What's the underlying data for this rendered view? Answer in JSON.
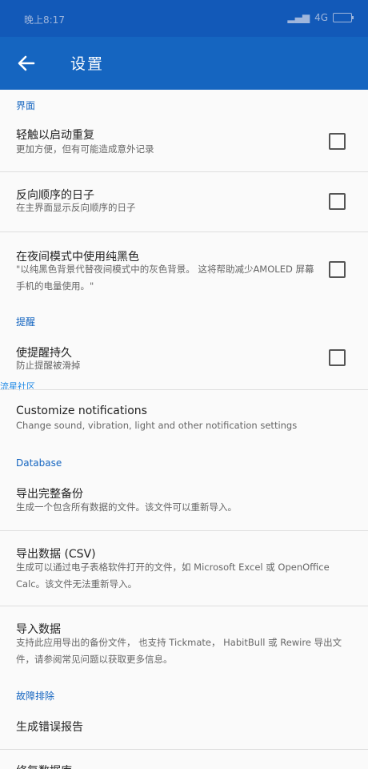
{
  "status_bar": {
    "time": "晚上8:17",
    "network": "4G"
  },
  "app_bar": {
    "title": "设置"
  },
  "watermark": "流星社区",
  "sections": {
    "interface": "界面",
    "reminders": "提醒",
    "database": "Database",
    "troubleshoot": "故障排除"
  },
  "items": {
    "tap_repeat": {
      "title": "轻触以启动重复",
      "sub": "更加方便，但有可能造成意外记录"
    },
    "reverse_days": {
      "title": "反向顺序的日子",
      "sub": "在主界面显示反向顺序的日子"
    },
    "pure_black": {
      "title": "在夜间模式中使用纯黑色",
      "sub": "\"以纯黑色背景代替夜间模式中的灰色背景。 这将帮助减少AMOLED 屏幕手机的电量使用。\""
    },
    "sticky_reminders": {
      "title": "使提醒持久",
      "sub": "防止提醒被滑掉"
    },
    "customize_notifications": {
      "title": "Customize notifications",
      "sub": "Change sound, vibration, light and other notification settings"
    },
    "export_backup": {
      "title": "导出完整备份",
      "sub": "生成一个包含所有数据的文件。该文件可以重新导入。"
    },
    "export_csv": {
      "title": "导出数据 (CSV)",
      "sub": "生成可以通过电子表格软件打开的文件，如 Microsoft Excel 或 OpenOffice Calc。该文件无法重新导入。"
    },
    "import_data": {
      "title": "导入数据",
      "sub": "支持此应用导出的备份文件， 也支持 Tickmate， HabitBull 或 Rewire 导出文件，请参阅常见问题以获取更多信息。"
    },
    "bug_report": {
      "title": "生成错误报告"
    },
    "repair_db": {
      "title": "修复数据库"
    }
  },
  "colors": {
    "primary": "#1565c0",
    "status_bar": "#1259b8"
  }
}
